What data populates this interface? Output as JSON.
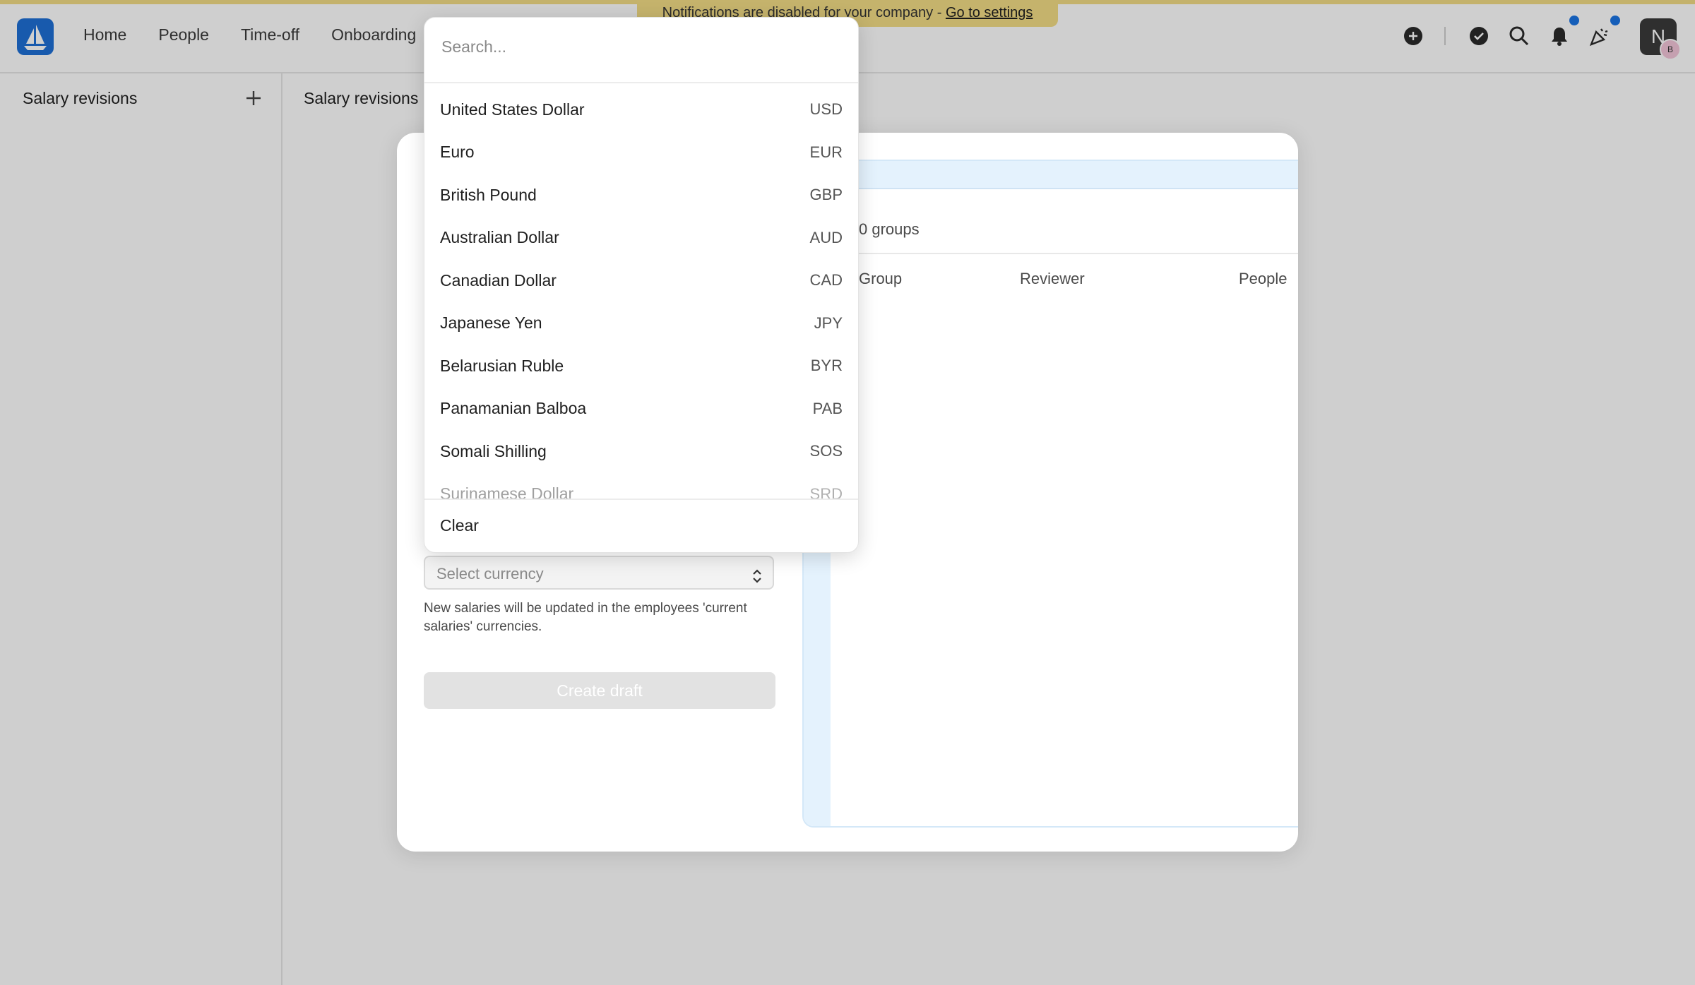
{
  "banner": {
    "text": "Notifications are disabled for your company - ",
    "link": "Go to settings"
  },
  "nav": [
    "Home",
    "People",
    "Time-off",
    "Onboarding"
  ],
  "icons": {
    "logo": "sailboat-logo-icon",
    "add": "plus-circle-icon",
    "tasks": "check-circle-icon",
    "search": "search-icon",
    "notifications": "bell-icon",
    "celebrations": "party-popper-icon"
  },
  "avatar": {
    "initial": "N",
    "badge": "B"
  },
  "sidebar": {
    "title": "Salary revisions"
  },
  "main": {
    "title": "Salary revisions"
  },
  "form": {
    "currency_placeholder": "Select currency",
    "help": "New salaries will be updated in the employees 'current salaries' currencies.",
    "create_label": "Create draft"
  },
  "preview": {
    "groups_count": "0 groups",
    "columns": [
      "Group",
      "Reviewer",
      "People"
    ]
  },
  "dropdown": {
    "search_placeholder": "Search...",
    "options": [
      {
        "name": "United States Dollar",
        "code": "USD"
      },
      {
        "name": "Euro",
        "code": "EUR"
      },
      {
        "name": "British Pound",
        "code": "GBP"
      },
      {
        "name": "Australian Dollar",
        "code": "AUD"
      },
      {
        "name": "Canadian Dollar",
        "code": "CAD"
      },
      {
        "name": "Japanese Yen",
        "code": "JPY"
      },
      {
        "name": "Belarusian Ruble",
        "code": "BYR"
      },
      {
        "name": "Panamanian Balboa",
        "code": "PAB"
      },
      {
        "name": "Somali Shilling",
        "code": "SOS"
      },
      {
        "name": "Surinamese Dollar",
        "code": "SRD"
      }
    ],
    "clear_label": "Clear"
  },
  "colors": {
    "accent": "#1b74e4",
    "banner": "#f3dd86",
    "preview_tint": "#e4f2fd"
  }
}
